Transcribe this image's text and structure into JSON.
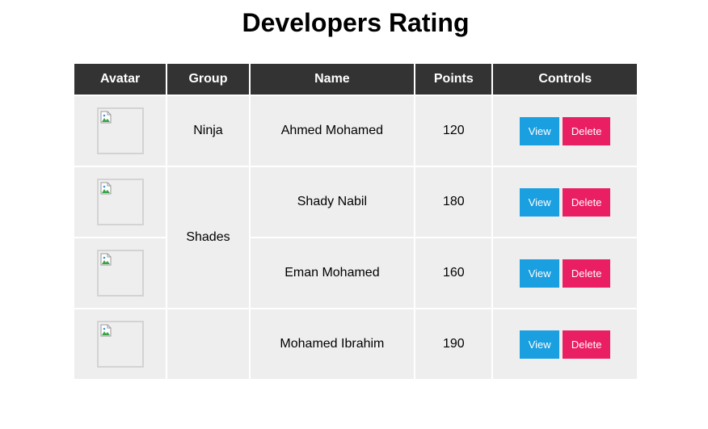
{
  "page": {
    "title": "Developers Rating"
  },
  "table": {
    "headers": [
      "Avatar",
      "Group",
      "Name",
      "Points",
      "Controls"
    ],
    "rows": [
      {
        "group": "Ninja",
        "name": "Ahmed Mohamed",
        "points": "120"
      },
      {
        "group": "Shades",
        "name": "Shady Nabil",
        "points": "180"
      },
      {
        "name": "Eman Mohamed",
        "points": "160"
      },
      {
        "group": "",
        "name": "Mohamed Ibrahim",
        "points": "190"
      }
    ]
  },
  "controls": {
    "view_label": "View",
    "delete_label": "Delete"
  },
  "colors": {
    "header_bg": "#333333",
    "cell_bg": "#eeeeee",
    "view_button": "#1a9fe0",
    "delete_button": "#e91e63"
  },
  "icons": {
    "avatar": "broken-image-icon"
  }
}
